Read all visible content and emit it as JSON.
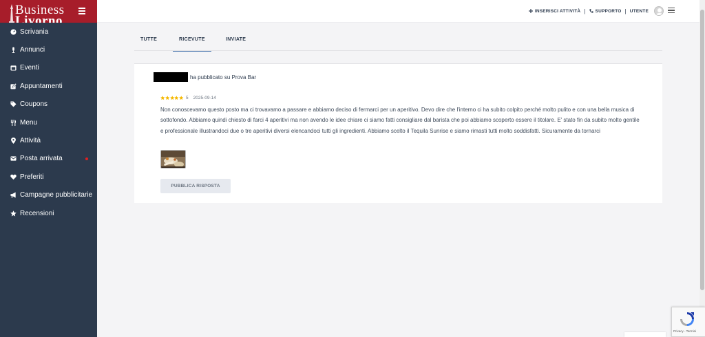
{
  "brand": {
    "line1": "Business",
    "line2": "Livorno"
  },
  "sidebar": {
    "items": [
      {
        "label": "Scrivania",
        "icon": "dashboard-icon"
      },
      {
        "label": "Annunci",
        "icon": "microphone-icon"
      },
      {
        "label": "Eventi",
        "icon": "calendar-icon"
      },
      {
        "label": "Appuntamenti",
        "icon": "edit-icon"
      },
      {
        "label": "Coupons",
        "icon": "tag-icon"
      },
      {
        "label": "Menu",
        "icon": "utensils-icon"
      },
      {
        "label": "Attività",
        "icon": "map-pin-icon"
      },
      {
        "label": "Posta arrivata",
        "icon": "envelope-icon",
        "badge_color": "#e02020"
      },
      {
        "label": "Preferiti",
        "icon": "heart-icon"
      },
      {
        "label": "Campagne pubblicitarie",
        "icon": "bullhorn-icon"
      },
      {
        "label": "Recensioni",
        "icon": "star-icon"
      }
    ]
  },
  "topbar": {
    "add_activity": "INSERISCI ATTIVITÀ",
    "support": "SUPPORTO",
    "user": "UTENTE"
  },
  "tabs": [
    {
      "label": "TUTTE"
    },
    {
      "label": "RICEVUTE",
      "active": true
    },
    {
      "label": "INVIATE"
    }
  ],
  "review": {
    "published_text": "ha pubblicato su Prova Bar",
    "stars": 5,
    "rating": "5",
    "date": "2025-09-14",
    "text": "Non conoscevamo questo posto ma ci trovavamo a passare e abbiamo deciso di fermarci per un aperitivo. Devo dire che l'interno ci ha subito colpito perché molto pulito e con una bella musica di sottofondo. Abbiamo quindi chiesto di farci 4 aperitivi ma non avendo le idee chiare ci siamo fatti consigliare dal barista che poi abbiamo scoperto essere il titolare. E' stato fin da subito molto gentile e professionale illustrandoci due o tre aperitivi diversi elencandoci tutti gli ingredienti. Abbiamo scelto il Tequila Sunrise e siamo rimasti tutti molto soddisfatti. Sicuramente da tornarci",
    "reply_button": "PUBBLICA RISPOSTA"
  },
  "recaptcha": {
    "text": "Privacy - Termini"
  },
  "colors": {
    "sidebar": "#2c3a4d",
    "brand": "#a71d2a",
    "star": "#f5b800",
    "accent": "#3a6aa8"
  }
}
